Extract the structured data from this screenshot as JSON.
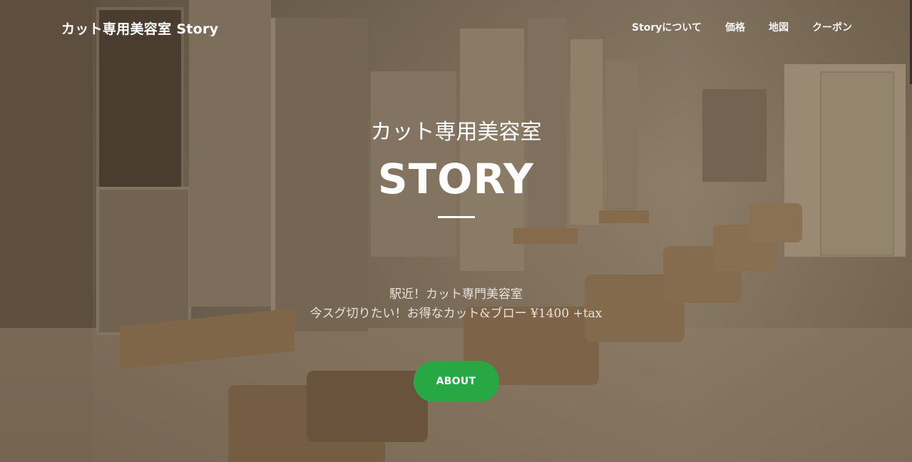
{
  "nav": {
    "brand": "カット専用美容室 Story",
    "links": [
      {
        "label": "Storyについて"
      },
      {
        "label": "価格"
      },
      {
        "label": "地図"
      },
      {
        "label": "クーポン"
      }
    ]
  },
  "hero": {
    "subtitle": "カット専用美容室",
    "title": "STORY",
    "tagline_line1": "駅近！カット専門美容室",
    "tagline_line2": "今スグ切りたい！お得なカット&ブロー ¥1400 +tax",
    "button_label": "ABOUT"
  },
  "colors": {
    "accent": "#28a745",
    "text": "#ffffff"
  }
}
